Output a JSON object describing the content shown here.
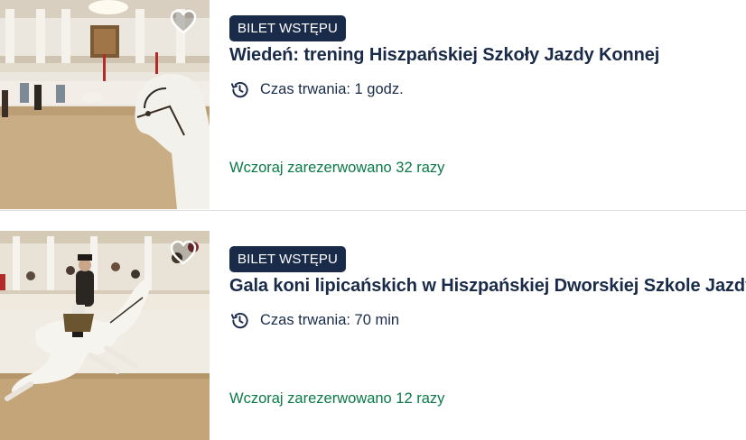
{
  "listings": [
    {
      "badge": "BILET WSTĘPU",
      "title": "Wiedeń: trening Hiszpańskiej Szkoły Jazdy Konnej",
      "duration": "Czas trwania: 1 godz.",
      "booked": "Wczoraj zarezerwowano 32 razy",
      "icons": {
        "favorite": "heart-outline-icon",
        "duration": "clock-history-icon"
      }
    },
    {
      "badge": "BILET WSTĘPU",
      "title": "Gala koni lipicańskich w Hiszpańskiej Dworskiej Szkole Jazdy",
      "duration": "Czas trwania: 70 min",
      "booked": "Wczoraj zarezerwowano 12 razy",
      "icons": {
        "favorite": "heart-outline-icon",
        "duration": "clock-history-icon"
      }
    }
  ],
  "colors": {
    "badge_bg": "#1a2b49",
    "title_text": "#1a2b49",
    "booked_text": "#0b7a47"
  }
}
